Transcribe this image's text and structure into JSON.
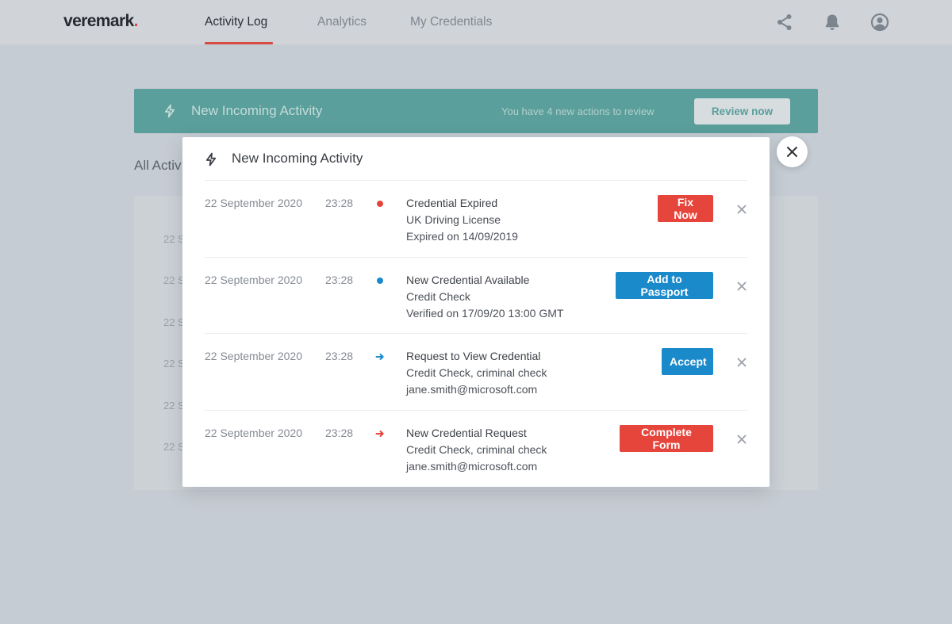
{
  "brand": {
    "name": "veremark",
    "dot": "."
  },
  "nav": {
    "tabs": [
      {
        "label": "Activity Log",
        "active": true
      },
      {
        "label": "Analytics",
        "active": false
      },
      {
        "label": "My Credentials",
        "active": false
      }
    ],
    "icons": [
      "share-icon",
      "bell-icon",
      "user-icon"
    ]
  },
  "banner": {
    "title": "New Incoming Activity",
    "message": "You have 4 new actions to review",
    "button_label": "Review now"
  },
  "background": {
    "heading": "All Activ",
    "row_date_fragment": "22 S"
  },
  "modal": {
    "title": "New Incoming Activity",
    "items": [
      {
        "date": "22 September 2020",
        "time": "23:28",
        "marker": "dot",
        "marker_color": "#e5453b",
        "title": "Credential Expired",
        "subtitle": "UK Driving License",
        "detail": "Expired on 14/09/2019",
        "action_label": "Fix Now",
        "action_color": "#e5453b"
      },
      {
        "date": "22 September 2020",
        "time": "23:28",
        "marker": "dot",
        "marker_color": "#1b8acb",
        "title": "New Credential Available",
        "subtitle": "Credit Check",
        "detail": "Verified on 17/09/20 13:00 GMT",
        "action_label": "Add to Passport",
        "action_color": "#1b8acb"
      },
      {
        "date": "22 September 2020",
        "time": "23:28",
        "marker": "arrow",
        "marker_color": "#1b8acb",
        "title": "Request to View Credential",
        "subtitle": "Credit Check, criminal check",
        "detail": "jane.smith@microsoft.com",
        "action_label": "Accept",
        "action_color": "#1b8acb"
      },
      {
        "date": "22 September 2020",
        "time": "23:28",
        "marker": "arrow",
        "marker_color": "#e5453b",
        "title": "New Credential Request",
        "subtitle": "Credit Check, criminal check",
        "detail": "jane.smith@microsoft.com",
        "action_label": "Complete Form",
        "action_color": "#e5453b"
      }
    ]
  },
  "colors": {
    "brand_accent": "#d9463d",
    "banner_teal": "#5a9f9b",
    "danger": "#e5453b",
    "primary": "#1b8acb"
  }
}
